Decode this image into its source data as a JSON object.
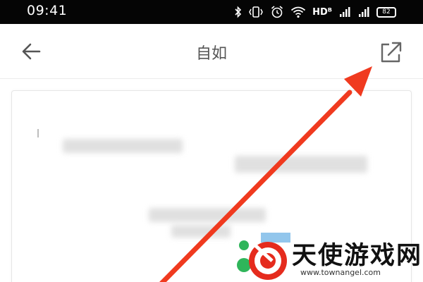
{
  "status_bar": {
    "time": "09:41",
    "network_label": "HDᴮ",
    "battery_level": "82",
    "icons": [
      "bluetooth-icon",
      "vibrate-icon",
      "alarm-icon",
      "wifi-icon",
      "signal-icon",
      "signal-icon",
      "battery-icon"
    ]
  },
  "app_bar": {
    "title": "自如",
    "back_icon": "arrow-left-icon",
    "share_icon": "share-external-icon"
  },
  "annotation": {
    "arrow_color": "#f03a1f"
  },
  "watermark": {
    "name": "天使游戏网",
    "url": "www.townangel.com"
  },
  "colors": {
    "status_bar_bg": "#050505",
    "app_bg": "#ffffff",
    "arrow": "#f03a1f",
    "logo_red": "#e52b1d",
    "logo_green": "#2fb55a"
  }
}
